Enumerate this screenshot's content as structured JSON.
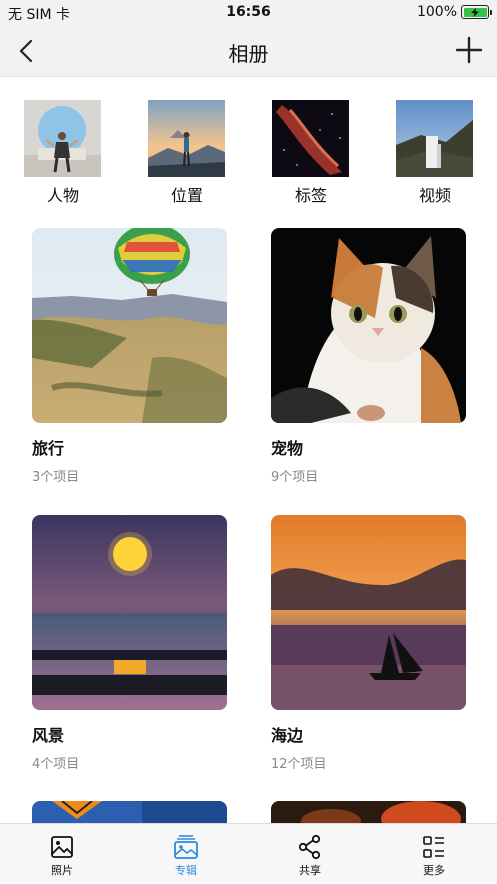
{
  "status_bar": {
    "carrier": "无 SIM 卡",
    "time": "16:56",
    "battery": "100%"
  },
  "nav": {
    "title": "相册",
    "back_icon": "chevron-left-icon",
    "add_icon": "plus-icon"
  },
  "categories": [
    {
      "label": "人物"
    },
    {
      "label": "位置"
    },
    {
      "label": "标签"
    },
    {
      "label": "视频"
    }
  ],
  "albums": [
    {
      "name": "旅行",
      "count": "3个项目"
    },
    {
      "name": "宠物",
      "count": "9个项目"
    },
    {
      "name": "风景",
      "count": "4个项目"
    },
    {
      "name": "海边",
      "count": "12个项目"
    }
  ],
  "tabs": [
    {
      "label": "照片",
      "icon": "photo-icon",
      "active": false
    },
    {
      "label": "专辑",
      "icon": "albums-icon",
      "active": true
    },
    {
      "label": "共享",
      "icon": "share-icon",
      "active": false
    },
    {
      "label": "更多",
      "icon": "more-list-icon",
      "active": false
    }
  ],
  "colors": {
    "accent": "#2d8be0",
    "battery": "#39c24a"
  }
}
